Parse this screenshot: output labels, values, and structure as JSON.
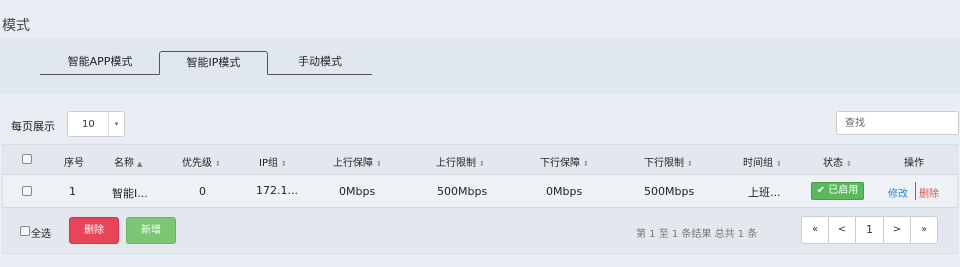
{
  "page_title": "模式",
  "tabs": [
    {
      "label": "智能APP模式"
    },
    {
      "label": "智能IP模式"
    },
    {
      "label": "手动模式"
    }
  ],
  "per_page": {
    "label": "每页展示",
    "value": "10",
    "arrow": "▾"
  },
  "search": {
    "placeholder": "查找"
  },
  "table": {
    "columns": [
      "序号",
      "名称",
      "优先级",
      "IP组",
      "上行保障",
      "上行限制",
      "下行保障",
      "下行限制",
      "时间组",
      "状态",
      "操作"
    ],
    "sort_glyph": "⇕",
    "sort_asc_glyph": "▲",
    "rows": [
      {
        "index": "1",
        "name": "智能I...",
        "priority": "0",
        "ip_group": "172.1...",
        "up_guarantee": "0Mbps",
        "up_limit": "500Mbps",
        "down_guarantee": "0Mbps",
        "down_limit": "500Mbps",
        "time_group": "上班...",
        "status": "✔ 已启用",
        "edit": "修改",
        "delete": "删除"
      }
    ]
  },
  "footer": {
    "select_all": "全选",
    "delete_button": "删除",
    "add_button": "新增",
    "info": "第 1 至 1 条结果  总共 1 条",
    "pager": {
      "first": "«",
      "prev": "<",
      "current": "1",
      "next": ">",
      "last": "»"
    }
  },
  "colors": {
    "status": "#5cb85c",
    "delete": "#e8445a",
    "add": "#7dc674",
    "link": "#2e86c8"
  }
}
